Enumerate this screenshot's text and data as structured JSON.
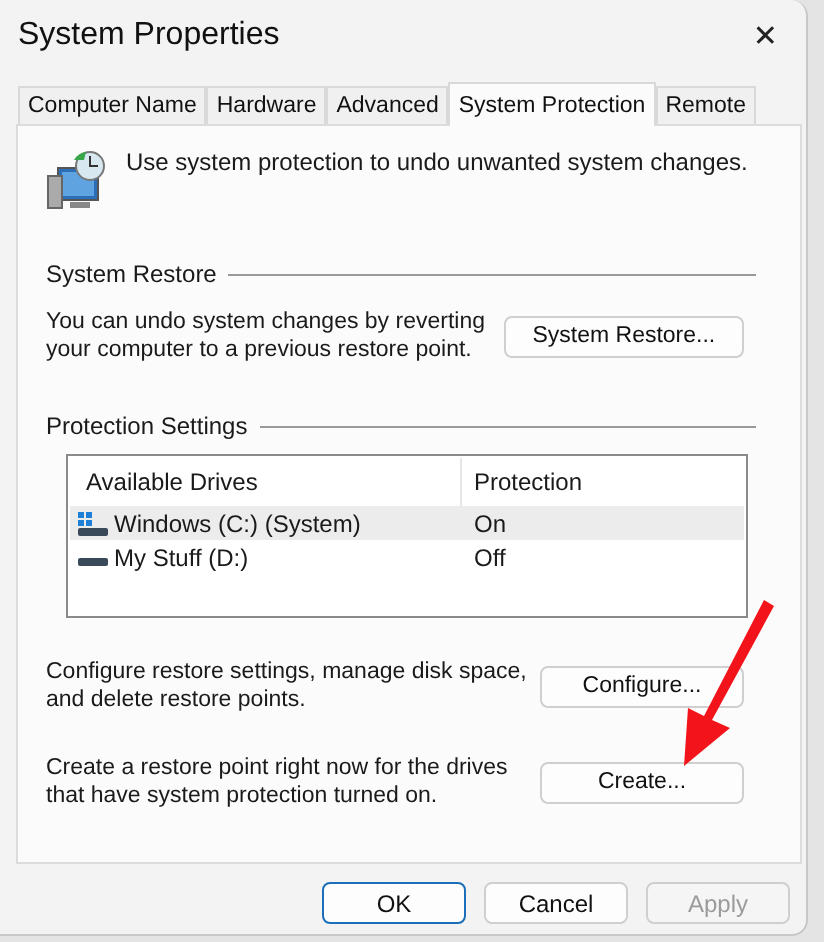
{
  "window": {
    "title": "System Properties",
    "close": "✕"
  },
  "tabs": [
    {
      "label": "Computer Name",
      "selected": false
    },
    {
      "label": "Hardware",
      "selected": false
    },
    {
      "label": "Advanced",
      "selected": false
    },
    {
      "label": "System Protection",
      "selected": true
    },
    {
      "label": "Remote",
      "selected": false
    }
  ],
  "intro": "Use system protection to undo unwanted system changes.",
  "system_restore": {
    "heading": "System Restore",
    "text": "You can undo system changes by reverting your computer to a previous restore point.",
    "button": "System Restore..."
  },
  "protection_settings": {
    "heading": "Protection Settings",
    "columns": [
      "Available Drives",
      "Protection"
    ],
    "rows": [
      {
        "kind": "system",
        "drive": "Windows (C:) (System)",
        "protection": "On",
        "selected": true
      },
      {
        "kind": "drive",
        "drive": "My Stuff (D:)",
        "protection": "Off",
        "selected": false
      }
    ],
    "actions": [
      {
        "text": "Configure restore settings, manage disk space, and delete restore points.",
        "button": "Configure..."
      },
      {
        "text": "Create a restore point right now for the drives that have system protection turned on.",
        "button": "Create..."
      }
    ]
  },
  "buttons": [
    {
      "label": "OK",
      "default": true,
      "disabled": false
    },
    {
      "label": "Cancel",
      "default": false,
      "disabled": false
    },
    {
      "label": "Apply",
      "default": false,
      "disabled": true
    }
  ]
}
